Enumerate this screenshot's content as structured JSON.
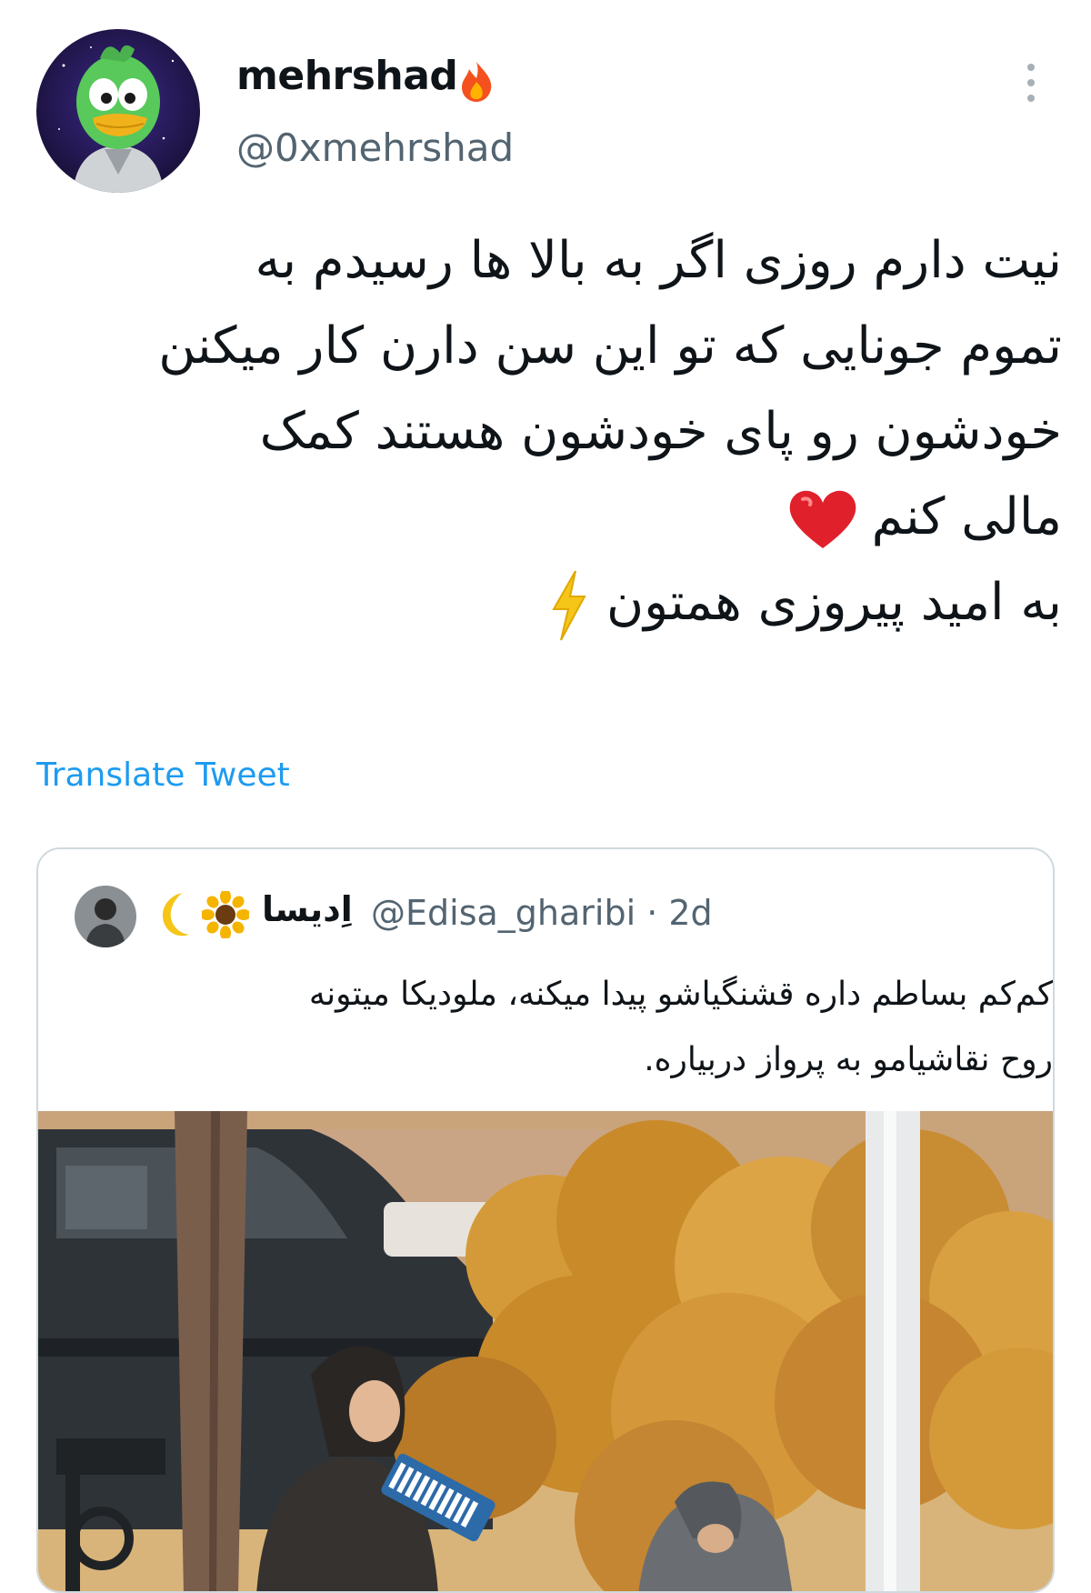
{
  "tweet": {
    "display_name": "mehrshad",
    "display_name_emoji": "fire-icon",
    "handle": "@0xmehrshad",
    "body_lines": [
      "نیت دارم روزی اگر به بالا ها رسیدم به",
      "تموم جونایی که تو این سن دارن کار میکنن",
      "خودشون رو پای خودشون هستند کمک",
      "مالی کنم"
    ],
    "closing_line": "به امید پیروزی همتون",
    "translate_label": "Translate Tweet",
    "more_icon": "more-vertical-icon",
    "accent_color": "#1d9bf0"
  },
  "quoted_tweet": {
    "display_name": "اِدیسا",
    "name_emojis": [
      "crescent-moon-icon",
      "sunflower-icon"
    ],
    "handle_time": "@Edisa_gharibi · 2d",
    "text_lines": [
      "کم‌کم بساطم داره قشنگیاشو پیدا میکنه، ملودیکا میتونه",
      "روح نقاشیامو به پرواز دربیاره."
    ]
  }
}
